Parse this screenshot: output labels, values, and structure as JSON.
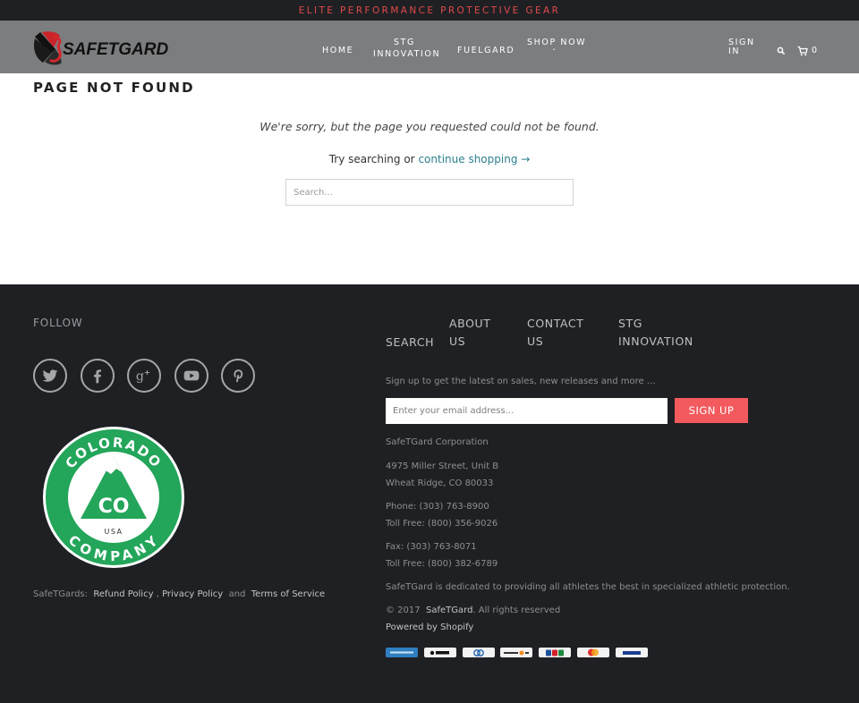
{
  "announcement": "ELITE PERFORMANCE PROTECTIVE GEAR",
  "logo_text": "SAFETGARD",
  "nav": {
    "home": "HOME",
    "stg_line1": "STG",
    "stg_line2": "INNOVATION",
    "fuelgard": "FUELGARD",
    "shop_now": "SHOP NOW",
    "shop_caret": "ˇ",
    "sign_line1": "SIGN",
    "sign_line2": "IN",
    "cart_count": "0"
  },
  "main": {
    "title": "PAGE NOT FOUND",
    "sorry": "We're sorry, but the page you requested could not be found.",
    "try_prefix": "Try searching or",
    "continue_link": "continue shopping →",
    "search_placeholder": "Search..."
  },
  "footer": {
    "follow": "FOLLOW",
    "social_icons": [
      "twitter-icon",
      "facebook-icon",
      "google-plus-icon",
      "youtube-icon",
      "pinterest-icon"
    ],
    "badge": {
      "top_text": "COLORADO",
      "bottom_text": "COMPANY",
      "center": "CO",
      "country": "USA"
    },
    "legal_prefix": "SafeTGards:",
    "refund": "Refund Policy",
    "comma": ",",
    "privacy": "Privacy Policy",
    "and": "and",
    "terms": "Terms of Service",
    "links": {
      "search": "SEARCH",
      "about_line1": "ABOUT",
      "about_line2": "US",
      "contact_line1": "CONTACT",
      "contact_line2": "US",
      "stg_line1": "STG",
      "stg_line2": "INNOVATION"
    },
    "newsletter_text": "Sign up to get the latest on sales, new releases and more …",
    "email_placeholder": "Enter your email address...",
    "signup_button": "SIGN UP",
    "company": "SafeTGard Corporation",
    "address_1": "4975 Miller Street, Unit B",
    "address_2": "Wheat Ridge, CO 80033",
    "phone": "Phone:  (303) 763-8900",
    "toll_free_1": "Toll Free:  (800) 356-9026",
    "fax": "Fax:  (303) 763-8071",
    "toll_free_2": "Toll Free:  (800) 382-6789",
    "mission": "SafeTGard is dedicated to providing all athletes the best in specialized athletic protection.",
    "copyright_prefix": "© 2017",
    "copyright_brand": "SafeTGard",
    "copyright_suffix": ". All rights reserved",
    "powered_by": "Powered by Shopify",
    "payment_icons": [
      "american-express-icon",
      "apple-pay-icon",
      "diners-club-icon",
      "discover-icon",
      "jcb-icon",
      "master-card-icon",
      "visa-icon"
    ]
  },
  "colors": {
    "accent_red": "#f25a5e",
    "footer_bg": "#1f2024",
    "header_bg": "#7c7d7f",
    "link_teal": "#2b7e8e",
    "badge_green": "#23a55a"
  }
}
